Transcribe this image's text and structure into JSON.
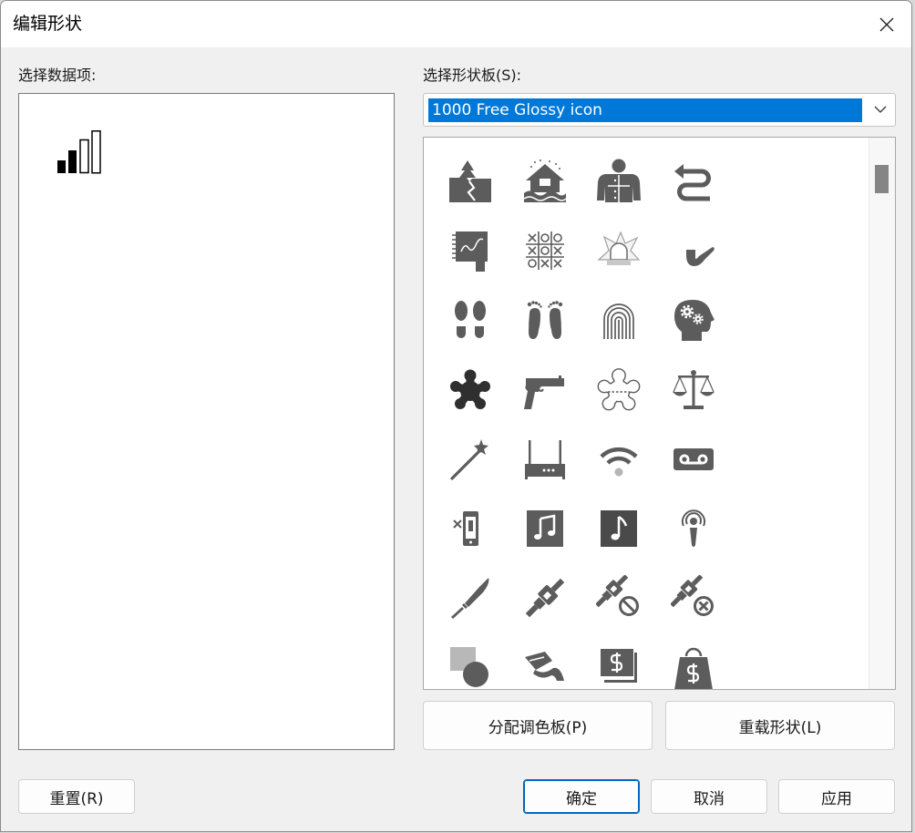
{
  "window": {
    "title": "编辑形状",
    "close_icon": "close-icon"
  },
  "data_items": {
    "label": "选择数据项:",
    "items": [
      {
        "icon": "signal-bars-icon"
      }
    ]
  },
  "shape_palette": {
    "label": "选择形状板(S):",
    "selected": "1000 Free Glossy icon",
    "dropdown_icon": "chevron-down-icon",
    "scroll_fraction": 0,
    "shapes": [
      "earthquake-icon",
      "flood-house-icon",
      "straitjacket-icon",
      "return-arrow-icon",
      "sketchbook-icon",
      "tic-tac-toe-icon",
      "siren-icon",
      "pipe-icon",
      "shoe-prints-icon",
      "bare-footprints-icon",
      "fingerprint-icon",
      "head-gears-icon",
      "body-outline-icon",
      "pistol-icon",
      "body-outline-dashed-icon",
      "scales-icon",
      "magic-wand-icon",
      "router-icon",
      "wifi-icon",
      "voicemail-icon",
      "phone-x-icon",
      "music-notes-icon",
      "music-note-icon",
      "podcast-icon",
      "knife-icon",
      "seatbelt-icon",
      "seatbelt-prohibited-icon",
      "seatbelt-cancel-icon",
      "shapes-icon",
      "hand-bowl-icon",
      "money-icon",
      "shopping-bag-dollar-icon"
    ]
  },
  "buttons": {
    "assign_palette": "分配调色板(P)",
    "reload_shapes": "重载形状(L)",
    "reset": "重置(R)",
    "ok": "确定",
    "cancel": "取消",
    "apply": "应用"
  },
  "colors": {
    "selection": "#0078d7",
    "icon": "#5c5c5c",
    "default_button_border": "#0067c0"
  }
}
